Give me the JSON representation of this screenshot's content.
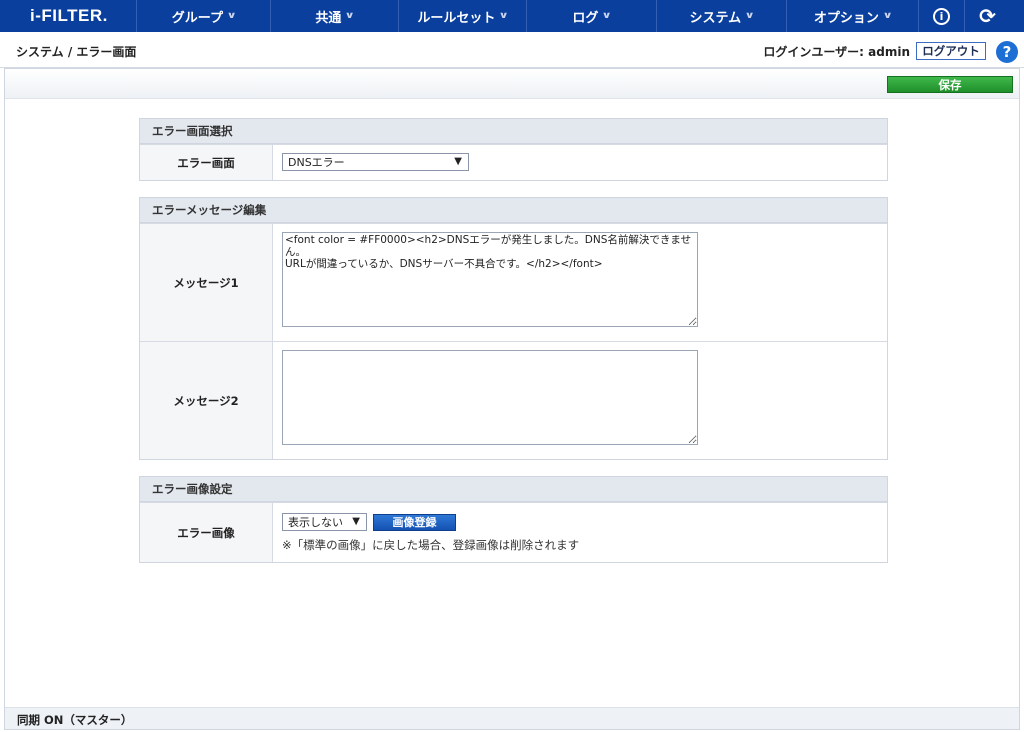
{
  "app": {
    "logo": "i-FILTER."
  },
  "nav": {
    "items": [
      {
        "label": "グループ"
      },
      {
        "label": "共通"
      },
      {
        "label": "ルールセット"
      },
      {
        "label": "ログ"
      },
      {
        "label": "システム"
      },
      {
        "label": "オプション"
      }
    ],
    "info_icon_glyph": "i",
    "refresh_icon_glyph": "⟳"
  },
  "header": {
    "breadcrumb": "システム / エラー画面",
    "login_user": "ログインユーザー: admin",
    "logout_label": "ログアウト",
    "help_glyph": "?"
  },
  "toolbar": {
    "save_label": "保存"
  },
  "error_screen_select": {
    "title": "エラー画面選択",
    "label": "エラー画面",
    "selected": "DNSエラー"
  },
  "message_edit": {
    "title": "エラーメッセージ編集",
    "message1_label": "メッセージ1",
    "message1_value": "<font color = #FF0000><h2>DNSエラーが発生しました。DNS名前解決できません。\nURLが間違っているか、DNSサーバー不具合です。</h2></font>",
    "message2_label": "メッセージ2",
    "message2_value": ""
  },
  "image_settings": {
    "title": "エラー画像設定",
    "label": "エラー画像",
    "selected": "表示しない",
    "register_label": "画像登録",
    "note": "※「標準の画像」に戻した場合、登録画像は削除されます"
  },
  "footer": {
    "sync_status": "同期 ON（マスター）"
  },
  "colors": {
    "nav_bg": "#0a3f9e",
    "save_green": "#1f8f2a",
    "action_blue": "#1452b2",
    "panel_header": "#e3e8ef"
  }
}
